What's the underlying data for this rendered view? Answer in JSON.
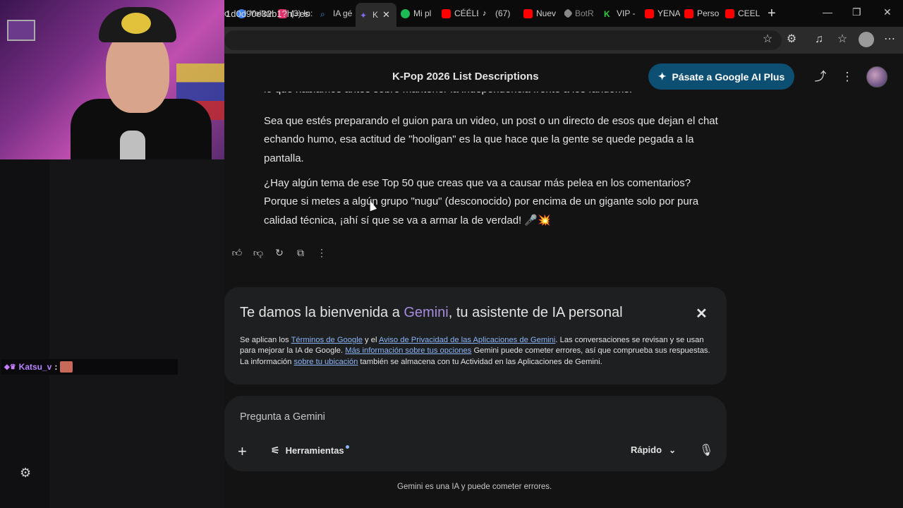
{
  "browser": {
    "tabs": [
      {
        "label": "o",
        "color": "#888888"
      },
      {
        "label": "Yellov",
        "color": "#3b82f6"
      },
      {
        "label": "(3) In:",
        "color": "#e1306c"
      },
      {
        "label": "IA gé",
        "color": "#4a90e2"
      },
      {
        "label": "K",
        "color": "#7c6cf0"
      },
      {
        "label": "Mi pl",
        "color": "#1db954"
      },
      {
        "label": "CÉÉLE",
        "color": "#ff0000"
      },
      {
        "label": "(67)",
        "color": "#ffffff"
      },
      {
        "label": "Nuev",
        "color": "#ff0000"
      },
      {
        "label": "BotR",
        "color": "#888888"
      },
      {
        "label": "VIP -",
        "color": "#2ecc40"
      },
      {
        "label": "YENA",
        "color": "#ff0000"
      },
      {
        "label": "Perso",
        "color": "#ff0000"
      },
      {
        "label": "CEELI",
        "color": "#ff0000"
      }
    ],
    "new_tab": "+",
    "url": "1d0d90e32b1?hl=es"
  },
  "chat_overlay": {
    "badges": "◆♛",
    "user": "Katsu_v",
    "colon": ":"
  },
  "gemini": {
    "title": "K-Pop 2026 List Descriptions",
    "upgrade_label": "Pásate a Google AI Plus",
    "response": {
      "partial_line": "lo que hablamos antes sobre mantener la independencia frente a los fandoms.",
      "p1": "Sea que estés preparando el guion para un video, un post o un directo de esos que dejan el chat echando humo, esa actitud de \"hooligan\" es la que hace que la gente se quede pegada a la pantalla.",
      "p2": "¿Hay algún tema de ese Top 50 que creas que va a causar más pelea en los comentarios? Porque si metes a algún grupo \"nugu\" (desconocido) por encima de un gigante solo por pura calidad técnica, ¡ahí sí que se va a armar la de verdad! 🎤💥"
    },
    "welcome": {
      "title_pre": "Te damos la bienvenida a ",
      "title_brand": "Gemini",
      "title_post": ", tu asistente de IA personal",
      "t1": "Se aplican los ",
      "link_terms": "Términos de Google",
      "t2": " y el ",
      "link_privacy": "Aviso de Privacidad de las Aplicaciones de Gemini",
      "t3": ". Las conversaciones se revisan y se usan para mejorar la IA de Google. ",
      "link_options": "Más información sobre tus opciones",
      "t4": " Gemini puede cometer errores, así que comprueba sus respuestas. La información ",
      "link_location": "sobre tu ubicación",
      "t5": " también se almacena con tu Actividad en las Aplicaciones de Gemini."
    },
    "prompt": {
      "placeholder": "Pregunta a Gemini",
      "tools_label": "Herramientas",
      "mode_label": "Rápido"
    },
    "disclaimer": "Gemini es una IA y puede cometer errores."
  }
}
